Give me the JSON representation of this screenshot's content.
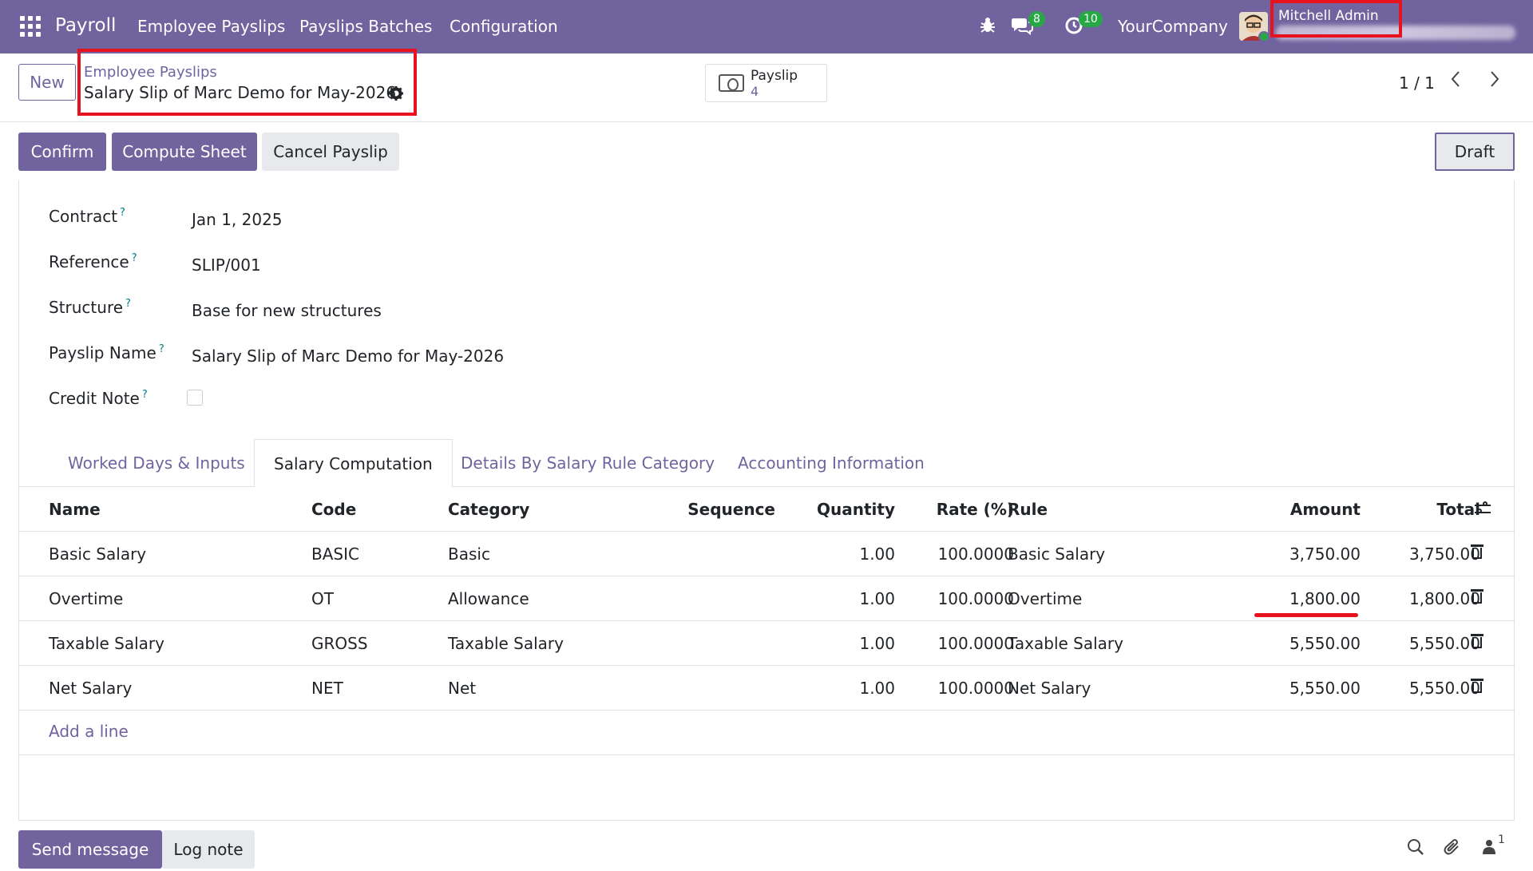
{
  "topbar": {
    "app_name": "Payroll",
    "menu": [
      "Employee Payslips",
      "Payslips Batches",
      "Configuration"
    ],
    "messages_count": "8",
    "activities_count": "10",
    "company": "YourCompany",
    "user": "Mitchell Admin",
    "colors": {
      "brand": "#71639e",
      "badge": "#28a745",
      "highlight": "#e8121f"
    }
  },
  "control": {
    "new_label": "New",
    "breadcrumb_parent": "Employee Payslips",
    "breadcrumb_current": "Salary Slip of Marc Demo for May-2026",
    "smart_button_label": "Payslip",
    "smart_button_count": "4",
    "pager": "1 / 1"
  },
  "actions": {
    "confirm": "Confirm",
    "compute_sheet": "Compute Sheet",
    "cancel_payslip": "Cancel Payslip",
    "status": "Draft"
  },
  "fields": {
    "contract_label": "Contract",
    "contract_value": "Jan 1, 2025",
    "reference_label": "Reference",
    "reference_value": "SLIP/001",
    "structure_label": "Structure",
    "structure_value": "Base for new structures",
    "payslip_name_label": "Payslip Name",
    "payslip_name_value": "Salary Slip of Marc Demo for May-2026",
    "credit_note_label": "Credit Note",
    "help_mark": "?"
  },
  "tabs": [
    "Worked Days & Inputs",
    "Salary Computation",
    "Details By Salary Rule Category",
    "Accounting Information"
  ],
  "table": {
    "headers": [
      "Name",
      "Code",
      "Category",
      "Sequence",
      "Quantity",
      "Rate (%)",
      "Rule",
      "Amount",
      "Total"
    ],
    "rows": [
      {
        "name": "Basic Salary",
        "code": "BASIC",
        "category": "Basic",
        "sequence": "",
        "quantity": "1.00",
        "rate": "100.0000",
        "rule": "Basic Salary",
        "amount": "3,750.00",
        "total": "3,750.00"
      },
      {
        "name": "Overtime",
        "code": "OT",
        "category": "Allowance",
        "sequence": "",
        "quantity": "1.00",
        "rate": "100.0000",
        "rule": "Overtime",
        "amount": "1,800.00",
        "total": "1,800.00"
      },
      {
        "name": "Taxable Salary",
        "code": "GROSS",
        "category": "Taxable Salary",
        "sequence": "",
        "quantity": "1.00",
        "rate": "100.0000",
        "rule": "Taxable Salary",
        "amount": "5,550.00",
        "total": "5,550.00"
      },
      {
        "name": "Net Salary",
        "code": "NET",
        "category": "Net",
        "sequence": "",
        "quantity": "1.00",
        "rate": "100.0000",
        "rule": "Net Salary",
        "amount": "5,550.00",
        "total": "5,550.00"
      }
    ],
    "add_line": "Add a line"
  },
  "chatter": {
    "send_message": "Send message",
    "log_note": "Log note",
    "followers_count": "1"
  }
}
